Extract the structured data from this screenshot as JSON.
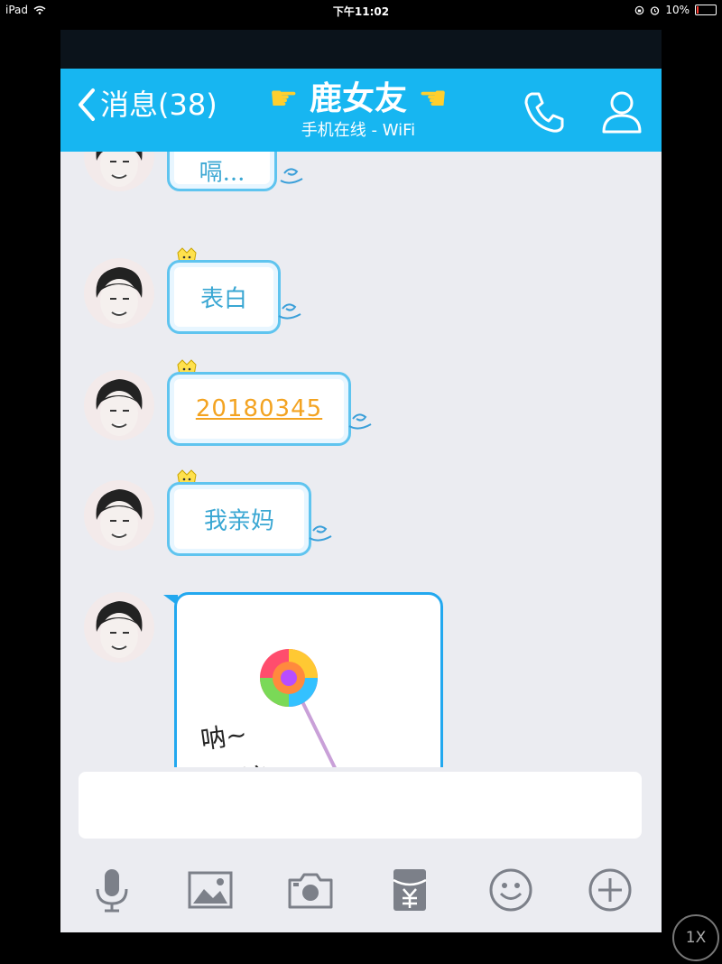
{
  "ipad_status": {
    "device": "iPad",
    "time": "下午11:02",
    "battery": "10%",
    "battery_level": 0.1
  },
  "header": {
    "back_label": "消息(38)",
    "title": "鹿女友",
    "subtitle": "手机在线 - WiFi"
  },
  "messages": [
    {
      "text": "嗝..."
    },
    {
      "text": "表白"
    },
    {
      "text": "20180345"
    },
    {
      "text": "我亲妈"
    }
  ],
  "sticker": {
    "line1": "呐~",
    "line2": "糖糖~"
  },
  "input": {
    "value": "",
    "placeholder": ""
  },
  "toolbar": {
    "icons": [
      "microphone-icon",
      "image-icon",
      "camera-icon",
      "red-packet-icon",
      "emoji-icon",
      "plus-icon"
    ]
  },
  "zoom_label": "1X",
  "colors": {
    "header": "#17b6f1",
    "chat_bg": "#ebecf1",
    "bubble_border": "#5fc4ef",
    "bubble_text": "#3aa7d3",
    "code_text": "#f3a321"
  }
}
